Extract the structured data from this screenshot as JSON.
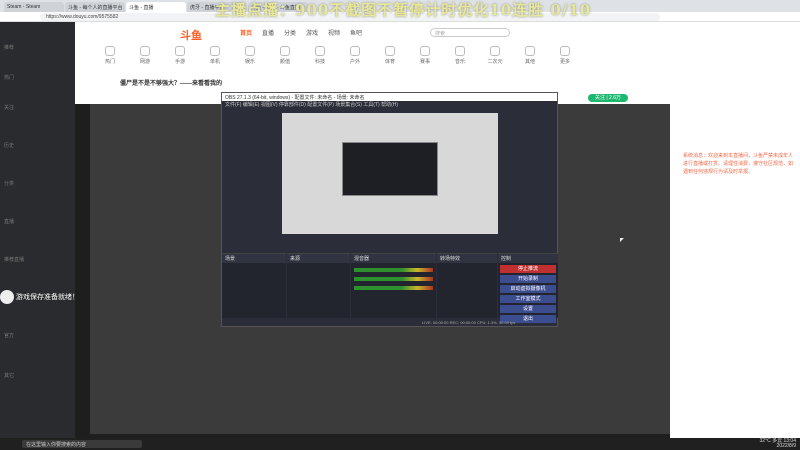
{
  "browser": {
    "tabs": [
      "Steam - Steam",
      "斗鱼 - 每个人的直播平台",
      "斗鱼 - 直播",
      "虎牙 - 直播平台",
      "斗鱼 - 直播 - 斗鱼直播"
    ],
    "url": "https://www.douyu.com/9575582"
  },
  "overlay": {
    "banner": "主播点播：900不截图不暂停计时优化10连胜 0/10"
  },
  "site": {
    "logo": "斗鱼",
    "nav": [
      "首页",
      "直播",
      "分类",
      "游戏",
      "视频",
      "鱼吧"
    ],
    "search_placeholder": "搜索",
    "categories": [
      "热门",
      "网游",
      "手游",
      "单机",
      "娱乐",
      "颜值",
      "科技",
      "户外",
      "体育",
      "赛事",
      "音乐",
      "二次元",
      "其他",
      "更多"
    ],
    "room_title": "僵尸是不是不够强大？——来看看我的",
    "follow_label": "关注 | 2.6万"
  },
  "sidebar": {
    "rows": [
      "推荐",
      "热门",
      "关注",
      "历史",
      "分类",
      "直播",
      "推荐直播",
      "官方",
      "其它"
    ]
  },
  "streamer_overlay": {
    "name": "游戏保存准备就绪！"
  },
  "obs": {
    "title": "OBS 27.1.3 (64-bit, windows) - 配置文件: 未命名 - 场景: 未命名",
    "menu": "文件(F)  编辑(E)  视图(V)  停靠部件(D)  配置文件(P)  场景集合(S)  工具(T)  帮助(H)",
    "panels": {
      "scenes": "场景",
      "sources": "来源",
      "mixer": "混音器",
      "transitions": "转场特效",
      "controls": "控制"
    },
    "controls": [
      "停止推流",
      "开始录制",
      "启动虚拟摄像机",
      "工作室模式",
      "设置",
      "退出"
    ],
    "status": "LIVE: 00:00:00   REC: 00:00:00   CPU: 1.3%, 30.00 fps"
  },
  "chat": {
    "message": "系统消息：欢迎来到本直播间，斗鱼严禁未成年人进行直播或打赏。请理性消费，遵守社区规范，如遇到任何违规行为请及时举报。"
  },
  "taskbar": {
    "search": "在这里输入你要搜索的内容",
    "time": "13:04",
    "date": "2022/8/9",
    "weather": "32°C 多云"
  }
}
